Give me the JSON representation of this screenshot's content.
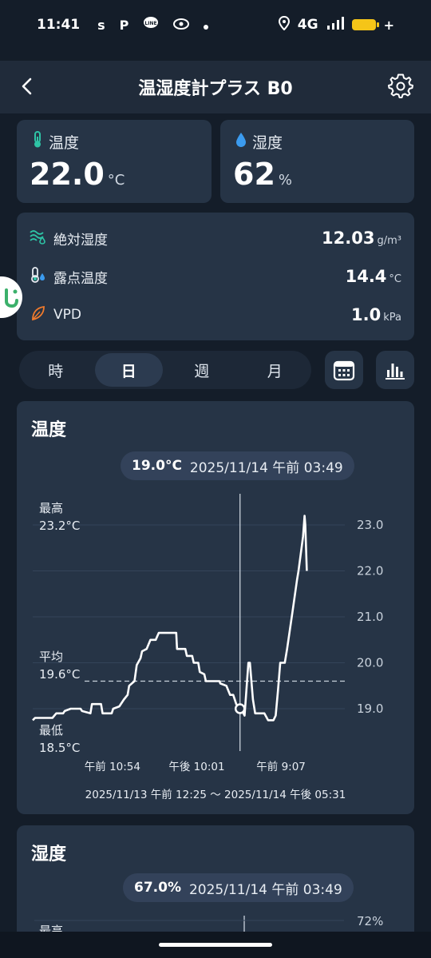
{
  "status_bar": {
    "time": "11:41",
    "notif_s": "s",
    "notif_p": "P",
    "notif_line": "LINE",
    "network": "4G"
  },
  "header": {
    "title": "温湿度計プラス B0"
  },
  "temperature": {
    "label": "温度",
    "value": "22.0",
    "unit": "°C"
  },
  "humidity": {
    "label": "湿度",
    "value": "62",
    "unit": "%"
  },
  "derived": [
    {
      "label": "絶対湿度",
      "value": "12.03",
      "unit": "g/m³",
      "icon": "absolute-humidity-icon"
    },
    {
      "label": "露点温度",
      "value": "14.4",
      "unit": "°C",
      "icon": "dew-point-icon"
    },
    {
      "label": "VPD",
      "value": "1.0",
      "unit": "kPa",
      "icon": "leaf-icon"
    }
  ],
  "period_tabs": [
    {
      "label": "時",
      "active": false
    },
    {
      "label": "日",
      "active": true
    },
    {
      "label": "週",
      "active": false
    },
    {
      "label": "月",
      "active": false
    }
  ],
  "temp_chart": {
    "title": "温度",
    "readout_value": "19.0°C",
    "readout_time": "2025/11/14 午前 03:49",
    "max_label": "最高",
    "max_value": "23.2°C",
    "avg_label": "平均",
    "avg_value": "19.6°C",
    "min_label": "最低",
    "min_value": "18.5°C",
    "range_text": "2025/11/13 午前 12:25 〜 2025/11/14 午後 05:31"
  },
  "chart_data": {
    "type": "line",
    "title": "温度",
    "xlabel": "",
    "ylabel": "",
    "ylim": [
      18.5,
      23.3
    ],
    "y_ticks": [
      "23.0",
      "22.0",
      "21.0",
      "20.0",
      "19.0"
    ],
    "x_tick_labels": [
      "午前 10:54",
      "午後 10:01",
      "午前 9:07"
    ],
    "x_range": [
      0,
      41.1
    ],
    "x_tick_positions": [
      10.5,
      21.6,
      32.7
    ],
    "average": 19.6,
    "cursor": {
      "x": 27.3,
      "y": 19.0
    },
    "grid": true,
    "series": [
      {
        "points": [
          [
            0.0,
            18.75
          ],
          [
            0.3,
            18.8
          ],
          [
            2.6,
            18.8
          ],
          [
            3.1,
            18.9
          ],
          [
            4.0,
            18.9
          ],
          [
            4.2,
            18.95
          ],
          [
            5.0,
            19.0
          ],
          [
            6.3,
            19.0
          ],
          [
            6.5,
            18.95
          ],
          [
            7.6,
            18.9
          ],
          [
            7.8,
            19.1
          ],
          [
            9.0,
            19.1
          ],
          [
            9.2,
            18.9
          ],
          [
            10.4,
            18.9
          ],
          [
            10.6,
            19.0
          ],
          [
            11.4,
            19.05
          ],
          [
            12.0,
            19.2
          ],
          [
            12.5,
            19.3
          ],
          [
            12.7,
            19.5
          ],
          [
            13.4,
            19.6
          ],
          [
            13.7,
            19.95
          ],
          [
            14.2,
            20.1
          ],
          [
            14.4,
            20.25
          ],
          [
            15.0,
            20.3
          ],
          [
            15.5,
            20.5
          ],
          [
            16.2,
            20.5
          ],
          [
            16.6,
            20.65
          ],
          [
            18.9,
            20.65
          ],
          [
            19.0,
            20.3
          ],
          [
            20.1,
            20.3
          ],
          [
            20.3,
            20.15
          ],
          [
            21.0,
            20.15
          ],
          [
            21.2,
            20.0
          ],
          [
            21.8,
            20.0
          ],
          [
            22.0,
            19.8
          ],
          [
            22.6,
            19.75
          ],
          [
            22.8,
            19.6
          ],
          [
            24.6,
            19.6
          ],
          [
            24.7,
            19.55
          ],
          [
            25.5,
            19.5
          ],
          [
            26.0,
            19.3
          ],
          [
            26.4,
            19.3
          ],
          [
            26.8,
            19.1
          ],
          [
            27.3,
            19.0
          ],
          [
            27.6,
            18.95
          ],
          [
            27.9,
            18.85
          ],
          [
            28.1,
            19.3
          ],
          [
            28.4,
            20.0
          ],
          [
            28.6,
            20.0
          ],
          [
            29.0,
            19.2
          ],
          [
            29.3,
            18.9
          ],
          [
            30.5,
            18.9
          ],
          [
            31.0,
            18.75
          ],
          [
            31.7,
            18.75
          ],
          [
            32.0,
            18.85
          ],
          [
            32.3,
            19.4
          ],
          [
            32.6,
            20.0
          ],
          [
            33.2,
            20.0
          ],
          [
            33.5,
            20.3
          ],
          [
            34.2,
            21.1
          ],
          [
            34.8,
            21.8
          ],
          [
            35.0,
            22.0
          ],
          [
            35.6,
            22.75
          ],
          [
            35.8,
            23.2
          ],
          [
            35.9,
            23.0
          ],
          [
            36.1,
            22.0
          ]
        ]
      }
    ]
  },
  "hum_chart": {
    "title": "湿度",
    "readout_value": "67.0%",
    "readout_time": "2025/11/14 午前 03:49",
    "max_label": "最高",
    "top_tick": "72%"
  },
  "colors": {
    "background": "#141d29",
    "card": "#263446",
    "accent_teal": "#2ec4a6",
    "accent_blue": "#3b9bef",
    "accent_orange": "#f07a2c",
    "line": "#ffffff"
  }
}
